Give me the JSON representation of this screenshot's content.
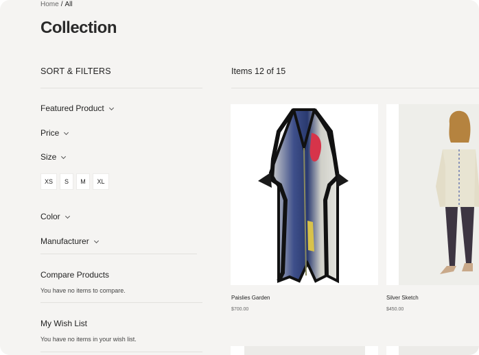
{
  "breadcrumb": {
    "home": "Home",
    "separator": "/",
    "current": "All"
  },
  "page_title": "Collection",
  "sidebar": {
    "heading": "SORT & FILTERS",
    "filters": [
      {
        "label": "Featured Product"
      },
      {
        "label": "Price"
      },
      {
        "label": "Size"
      },
      {
        "label": "Color"
      },
      {
        "label": "Manufacturer"
      }
    ],
    "sizes": [
      "XS",
      "S",
      "M",
      "XL"
    ],
    "compare": {
      "title": "Compare Products",
      "text": "You have no items to compare."
    },
    "wishlist": {
      "title": "My Wish List",
      "text": "You have no items in your wish list."
    }
  },
  "toolbar": {
    "items_label": "Items 12 of 15"
  },
  "products": [
    {
      "name": "Paislies Garden",
      "price": "$700.00"
    },
    {
      "name": "Silver Sketch",
      "price": "$450.00"
    }
  ],
  "colors": {
    "background": "#f5f4f2",
    "card": "#ffffff",
    "text": "#222222"
  }
}
